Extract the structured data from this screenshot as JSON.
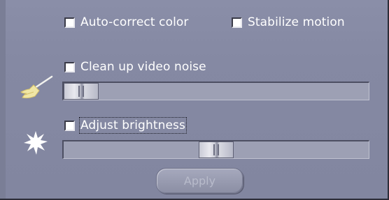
{
  "checkboxes": {
    "auto_correct_color": {
      "label": "Auto-correct color",
      "checked": false
    },
    "stabilize_motion": {
      "label": "Stabilize motion",
      "checked": false
    },
    "clean_up_video_noise": {
      "label": "Clean up video noise",
      "checked": false
    },
    "adjust_brightness": {
      "label": "Adjust brightness",
      "checked": false
    }
  },
  "sliders": {
    "noise_level": {
      "value_fraction": 0.0
    },
    "brightness_level": {
      "value_fraction": 0.5
    }
  },
  "icons": {
    "noise": "broom-icon",
    "brightness": "sun-burst-icon"
  },
  "buttons": {
    "apply_label": "Apply",
    "apply_enabled": false
  },
  "colors": {
    "panel_background": "#8286a0",
    "label_text": "#ffffff",
    "disabled_button_text": "#b8bbcb"
  }
}
